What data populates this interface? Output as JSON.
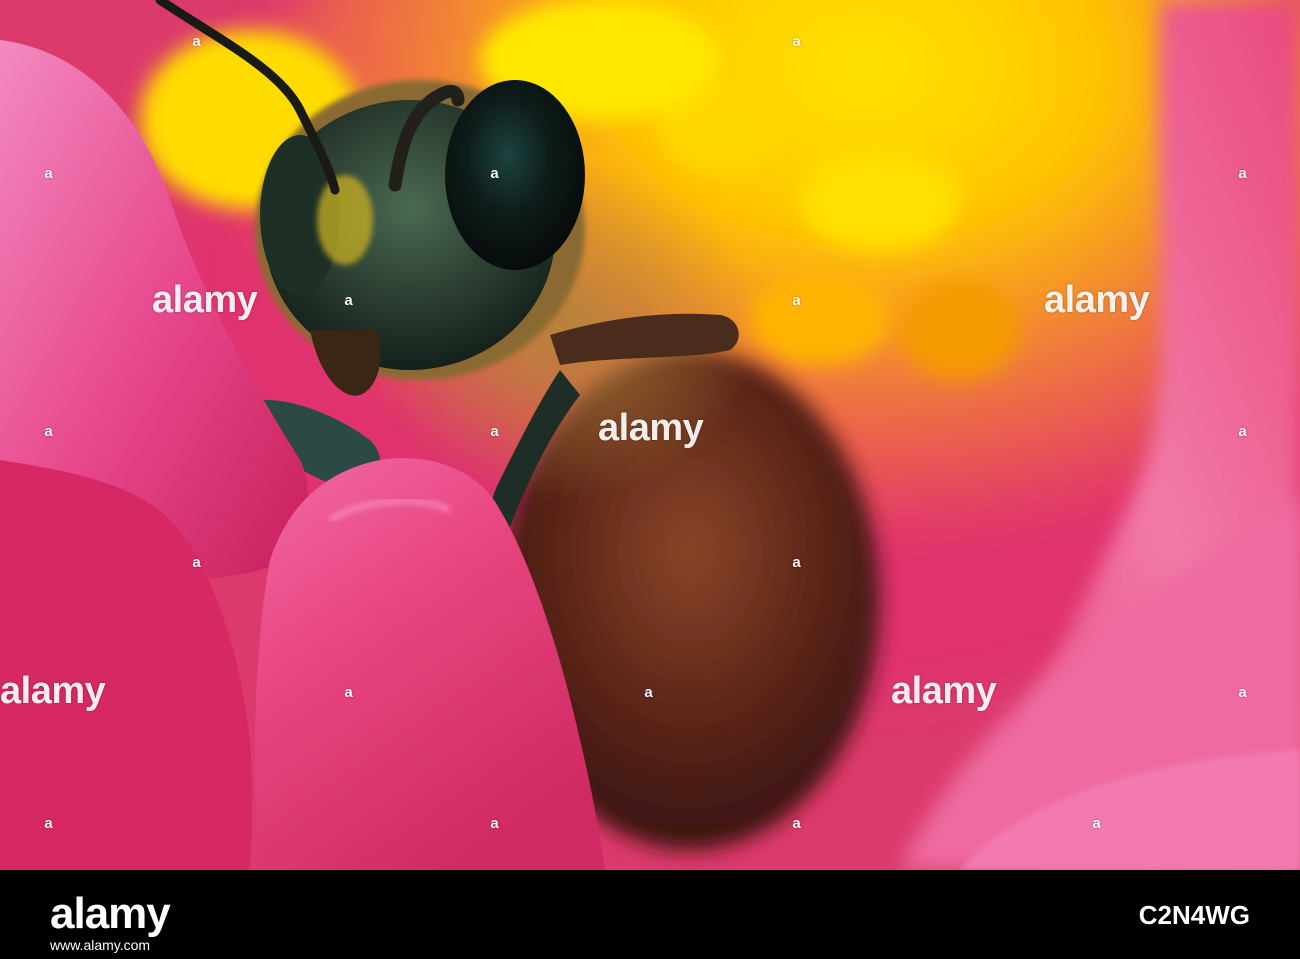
{
  "photo": {
    "subject": "honeybee",
    "colors": {
      "petal_pink": "#e0306e",
      "petal_light": "#f07cb0",
      "center_yellow": "#ffd200",
      "center_orange": "#f5a000",
      "bee_dark": "#1c2a22",
      "bee_body": "#6a3020"
    }
  },
  "watermark": {
    "text": "alamy",
    "dot_glyph": "a"
  },
  "footer": {
    "logo": "alamy",
    "url": "www.alamy.com",
    "image_id": "C2N4WG"
  }
}
